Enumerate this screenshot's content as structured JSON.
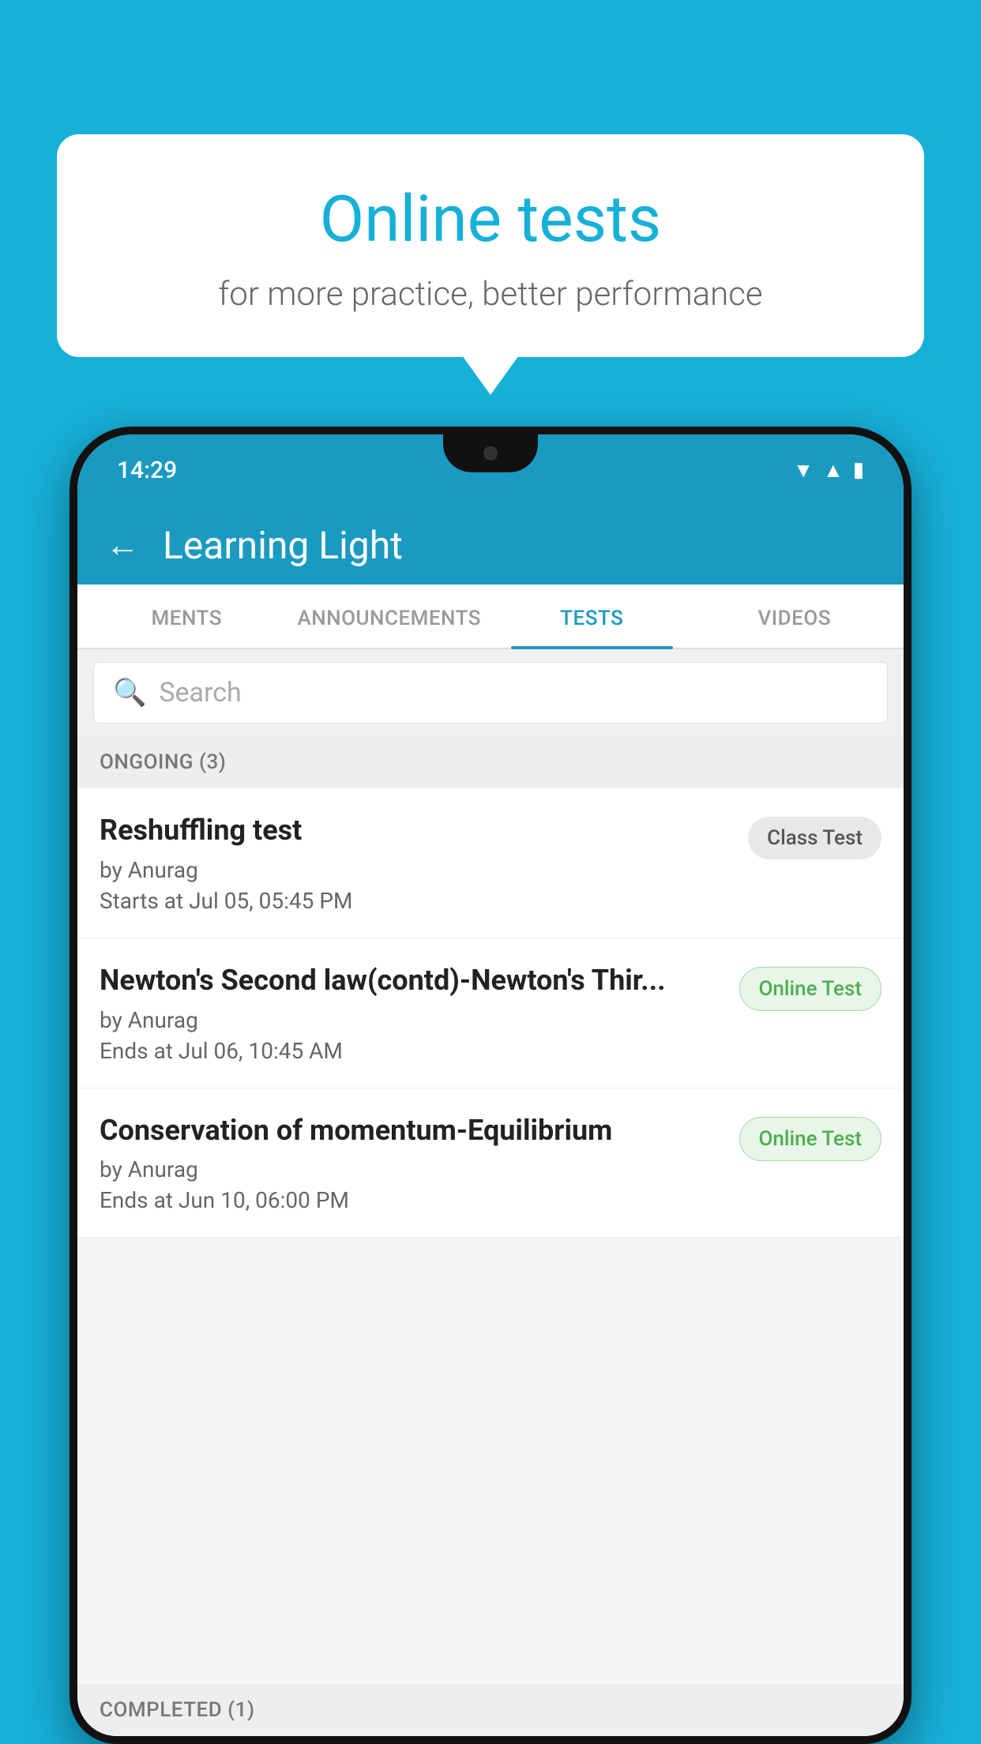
{
  "background": {
    "color": "#17b0d8"
  },
  "speechBubble": {
    "title": "Online tests",
    "subtitle": "for more practice, better performance"
  },
  "phone": {
    "statusBar": {
      "time": "14:29",
      "icons": [
        "wifi",
        "signal",
        "battery"
      ]
    },
    "appHeader": {
      "title": "Learning Light",
      "backLabel": "←"
    },
    "tabs": [
      {
        "label": "MENTS",
        "active": false
      },
      {
        "label": "ANNOUNCEMENTS",
        "active": false
      },
      {
        "label": "TESTS",
        "active": true
      },
      {
        "label": "VIDEOS",
        "active": false
      }
    ],
    "search": {
      "placeholder": "Search"
    },
    "ongoingSection": {
      "label": "ONGOING (3)"
    },
    "tests": [
      {
        "name": "Reshuffling test",
        "author": "by Anurag",
        "timeLabel": "Starts at",
        "time": "Jul 05, 05:45 PM",
        "badge": "Class Test",
        "badgeType": "class"
      },
      {
        "name": "Newton's Second law(contd)-Newton's Thir...",
        "author": "by Anurag",
        "timeLabel": "Ends at",
        "time": "Jul 06, 10:45 AM",
        "badge": "Online Test",
        "badgeType": "online"
      },
      {
        "name": "Conservation of momentum-Equilibrium",
        "author": "by Anurag",
        "timeLabel": "Ends at",
        "time": "Jun 10, 06:00 PM",
        "badge": "Online Test",
        "badgeType": "online"
      }
    ],
    "completedSection": {
      "label": "COMPLETED (1)"
    }
  }
}
